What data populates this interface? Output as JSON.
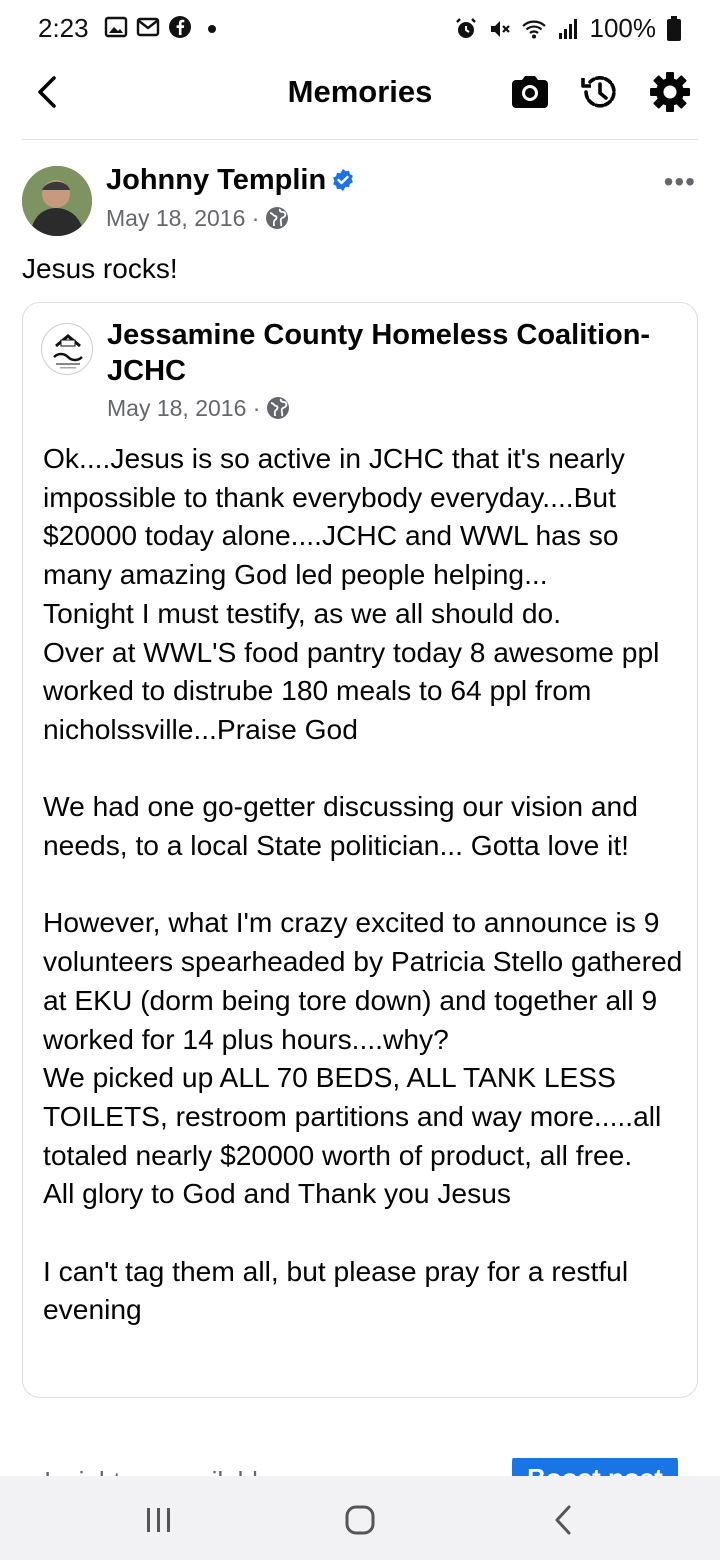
{
  "status_bar": {
    "time": "2:23",
    "left_icons": [
      "gallery-icon",
      "gmail-icon",
      "facebook-icon",
      "dot-icon"
    ],
    "right_icons": [
      "alarm-icon",
      "mute-icon",
      "wifi-icon",
      "signal-icon"
    ],
    "battery": "100%"
  },
  "header": {
    "title": "Memories",
    "icons": [
      "back-icon",
      "camera-icon",
      "history-icon",
      "settings-icon"
    ]
  },
  "post": {
    "author": "Johnny Templin",
    "verified": true,
    "date": "May 18, 2016 ·",
    "privacy_icon": "globe-icon",
    "more": "•••",
    "caption": "Jesus rocks!",
    "shared": {
      "page_name": "Jessamine County Homeless Coalition-JCHC",
      "date": "May 18, 2016 ·",
      "body": "Ok....Jesus is so active in JCHC that it's nearly impossible to thank everybody everyday....But $20000 today alone....JCHC and WWL has so many amazing God led people helping...\nTonight I must testify, as we all should do.\nOver at WWL'S  food pantry today 8 awesome ppl worked to distrube 180 meals to 64 ppl from nicholssville...Praise God\n\nWe had one go-getter discussing our vision and needs, to a local State politician... Gotta love it!\n\nHowever, what I'm crazy excited to announce is 9 volunteers spearheaded by Patricia Stello gathered at EKU (dorm being tore down) and together all 9 worked for 14 plus hours....why?\nWe picked up ALL 70 BEDS, ALL TANK LESS TOILETS, restroom partitions  and way more.....all totaled nearly $20000 worth of product, all free.\nAll glory to God and Thank you Jesus\n\nI can't tag them all, but please pray for a restful evening"
    }
  },
  "footer_peek": {
    "insights": "Insights unavailable",
    "cta": "Boost post"
  },
  "nav_bar": {
    "icons": [
      "recents-icon",
      "home-icon",
      "back-nav-icon"
    ]
  },
  "colors": {
    "accent": "#1b74e4",
    "secondary_text": "#65676b",
    "border": "#dadde1"
  }
}
